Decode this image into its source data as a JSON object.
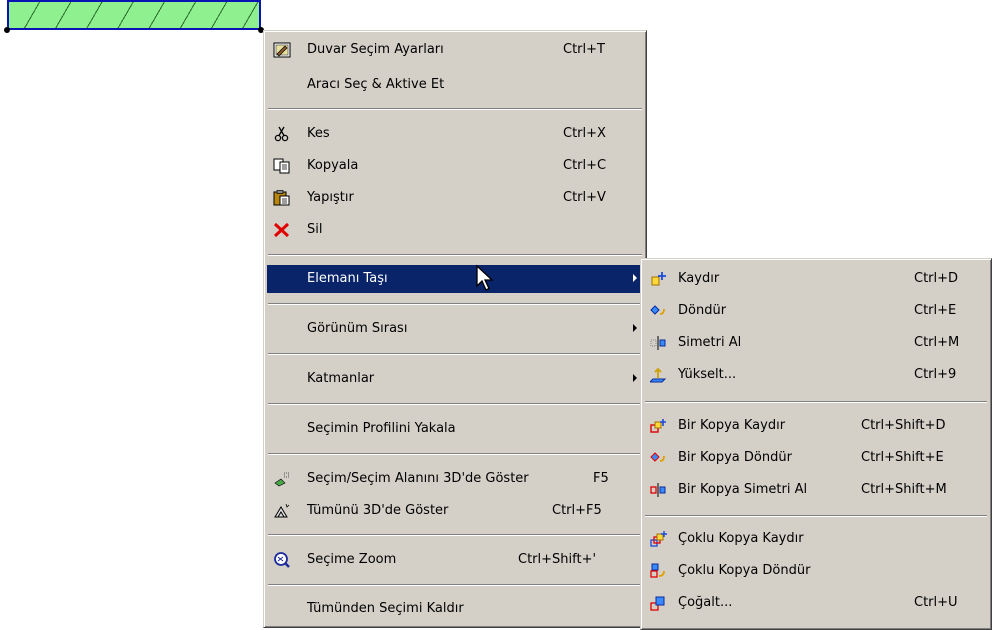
{
  "main_menu": {
    "wall_settings": {
      "label": "Duvar Seçim Ayarları",
      "shortcut": "Ctrl+T",
      "icon": "wall-settings-icon"
    },
    "select_activate_tool": {
      "label": "Aracı Seç & Aktive Et"
    },
    "cut": {
      "label": "Kes",
      "shortcut": "Ctrl+X",
      "icon": "scissors-icon"
    },
    "copy": {
      "label": "Kopyala",
      "shortcut": "Ctrl+C",
      "icon": "copy-icon"
    },
    "paste": {
      "label": "Yapıştır",
      "shortcut": "Ctrl+V",
      "icon": "paste-icon"
    },
    "delete": {
      "label": "Sil",
      "icon": "red-x-icon"
    },
    "move_element": {
      "label": "Elemanı Taşı"
    },
    "display_order": {
      "label": "Görünüm Sırası"
    },
    "layers": {
      "label": "Katmanlar"
    },
    "capture_profile": {
      "label": "Seçimin Profilini Yakala"
    },
    "show_3d_selection": {
      "label": "Seçim/Seçim Alanını 3D'de Göster",
      "shortcut": "F5",
      "icon": "3d-selection-icon"
    },
    "show_all_3d": {
      "label": "Tümünü 3D'de Göster",
      "shortcut": "Ctrl+F5",
      "icon": "3d-all-icon"
    },
    "zoom_selection": {
      "label": "Seçime Zoom",
      "shortcut": "Ctrl+Shift+'",
      "icon": "zoom-icon"
    },
    "deselect_all": {
      "label": "Tümünden Seçimi Kaldır"
    }
  },
  "sub_menu": {
    "drag": {
      "label": "Kaydır",
      "shortcut": "Ctrl+D",
      "icon": "drag-icon"
    },
    "rotate": {
      "label": "Döndür",
      "shortcut": "Ctrl+E",
      "icon": "rotate-icon"
    },
    "mirror": {
      "label": "Simetri Al",
      "shortcut": "Ctrl+M",
      "icon": "mirror-icon"
    },
    "elevate": {
      "label": "Yükselt...",
      "shortcut": "Ctrl+9",
      "icon": "elevate-icon"
    },
    "drag_copy": {
      "label": "Bir Kopya Kaydır",
      "shortcut": "Ctrl+Shift+D",
      "icon": "drag-copy-icon"
    },
    "rotate_copy": {
      "label": "Bir Kopya Döndür",
      "shortcut": "Ctrl+Shift+E",
      "icon": "rotate-copy-icon"
    },
    "mirror_copy": {
      "label": "Bir Kopya Simetri Al",
      "shortcut": "Ctrl+Shift+M",
      "icon": "mirror-copy-icon"
    },
    "drag_multi": {
      "label": "Çoklu Kopya Kaydır",
      "icon": "multi-drag-icon"
    },
    "rotate_multi": {
      "label": "Çoklu Kopya Döndür",
      "icon": "multi-rotate-icon"
    },
    "multiply": {
      "label": "Çoğalt...",
      "shortcut": "Ctrl+U",
      "icon": "multiply-icon"
    }
  }
}
